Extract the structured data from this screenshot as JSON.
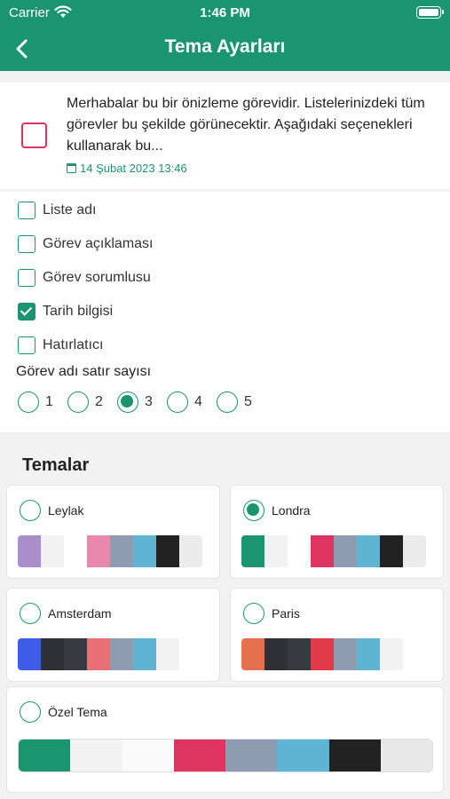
{
  "status": {
    "carrier": "Carrier",
    "time": "1:46 PM"
  },
  "nav": {
    "title": "Tema Ayarları",
    "back_icon": "chevron-left-icon"
  },
  "preview": {
    "text": "Merhabalar bu bir önizleme görevidir. Listelerinizdeki tüm görevler bu şekilde görünecektir. Aşağıdaki seçenekleri kullanarak bu...",
    "date": "14 Şubat 2023 13:46"
  },
  "options": [
    {
      "label": "Liste adı",
      "checked": false
    },
    {
      "label": "Görev açıklaması",
      "checked": false
    },
    {
      "label": "Görev sorumlusu",
      "checked": false
    },
    {
      "label": "Tarih bilgisi",
      "checked": true
    },
    {
      "label": "Hatırlatıcı",
      "checked": false
    }
  ],
  "lines": {
    "label": "Görev adı satır sayısı",
    "values": [
      "1",
      "2",
      "3",
      "4",
      "5"
    ],
    "selected": "3"
  },
  "themes": {
    "title": "Temalar",
    "selected": "Londra",
    "items": [
      {
        "name": "Leylak",
        "colors": [
          "#a88fc9",
          "#f2f2f2",
          "#e889ac",
          "#8e9bb0",
          "#5db5d2",
          "#222222",
          "#ececec"
        ]
      },
      {
        "name": "Londra",
        "colors": [
          "#1b9470",
          "#f2f2f2",
          "#dd3560",
          "#8e9bb0",
          "#5db5d2",
          "#222222",
          "#ececec"
        ]
      },
      {
        "name": "Amsterdam",
        "colors": [
          "#3f5ce8",
          "#2f3136",
          "#373a40",
          "#e87074",
          "#8e9bb0",
          "#5db5d2",
          "#f2f2f2",
          "#ffffff"
        ]
      },
      {
        "name": "Paris",
        "colors": [
          "#e4704e",
          "#2f3136",
          "#373a40",
          "#e23a48",
          "#8e9bb0",
          "#5db5d2",
          "#f2f2f2",
          "#ffffff"
        ]
      }
    ],
    "custom": {
      "name": "Özel Tema",
      "colors": [
        "#1b9470",
        "#f2f2f2",
        "#fafafa",
        "#dd3560",
        "#8e9bb0",
        "#5db5d2",
        "#222222",
        "#e8e8e8"
      ]
    }
  }
}
